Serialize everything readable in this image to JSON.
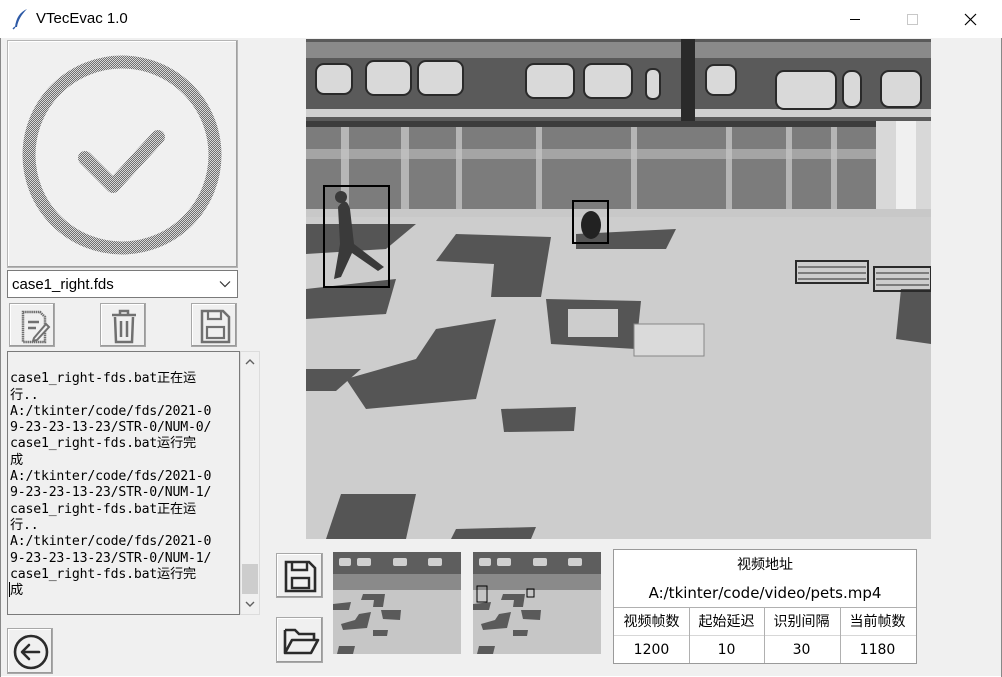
{
  "window": {
    "title": "VTecEvac 1.0",
    "controls": [
      "minimize",
      "maximize",
      "close"
    ]
  },
  "status_button": {
    "icon": "check-circle-icon"
  },
  "case_select": {
    "value": "case1_right.fds"
  },
  "tool_buttons": [
    "edit-file-icon",
    "trash-icon",
    "save-icon"
  ],
  "log": {
    "lines": [
      "case1_right-fds.bat正在运",
      "行..",
      "A:/tkinter/code/fds/2021-0",
      "9-23-23-13-23/STR-0/NUM-0/",
      "case1_right-fds.bat运行完",
      "成",
      "A:/tkinter/code/fds/2021-0",
      "9-23-23-13-23/STR-0/NUM-1/",
      "case1_right-fds.bat正在运",
      "行..",
      "A:/tkinter/code/fds/2021-0",
      "9-23-23-13-23/STR-0/NUM-1/",
      "case1_right-fds.bat运行完",
      "成"
    ],
    "scroll_position": 0.85
  },
  "back_button": {
    "icon": "arrow-left-circle-icon"
  },
  "video_buttons": [
    "save-icon",
    "open-folder-icon"
  ],
  "video_info": {
    "path_label": "视频地址",
    "path_value": "A:/tkinter/code/video/pets.mp4",
    "columns": [
      {
        "label": "视频帧数",
        "value": "1200"
      },
      {
        "label": "起始延迟",
        "value": "10"
      },
      {
        "label": "识别间隔",
        "value": "30"
      },
      {
        "label": "当前帧数",
        "value": "1180"
      }
    ]
  }
}
